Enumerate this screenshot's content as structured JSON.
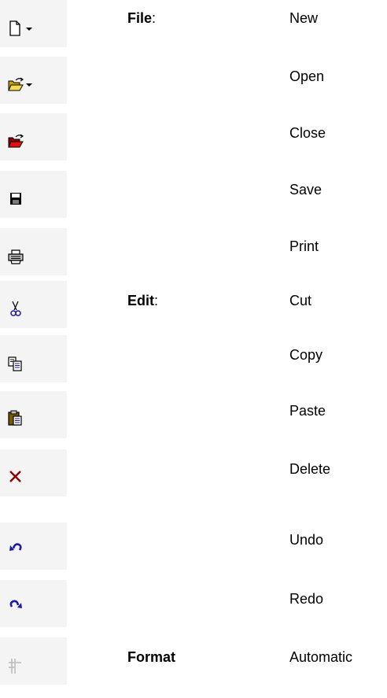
{
  "rows": [
    {
      "icon": "new-document-dropdown-icon",
      "category": "File",
      "category_suffix": ":",
      "command": "New"
    },
    {
      "icon": "open-folder-dropdown-icon",
      "category": "",
      "category_suffix": "",
      "command": "Open"
    },
    {
      "icon": "close-folder-icon",
      "category": "",
      "category_suffix": "",
      "command": "Close"
    },
    {
      "icon": "save-disk-icon",
      "category": "",
      "category_suffix": "",
      "command": "Save"
    },
    {
      "icon": "printer-icon",
      "category": "",
      "category_suffix": "",
      "command": "Print"
    },
    {
      "icon": "scissors-icon",
      "category": "Edit",
      "category_suffix": ":",
      "command": "Cut"
    },
    {
      "icon": "copy-icon",
      "category": "",
      "category_suffix": "",
      "command": "Copy"
    },
    {
      "icon": "paste-clipboard-icon",
      "category": "",
      "category_suffix": "",
      "command": "Paste"
    },
    {
      "icon": "delete-x-icon",
      "category": "",
      "category_suffix": "",
      "command": "Delete"
    },
    {
      "icon": "undo-arrow-icon",
      "category": "",
      "category_suffix": "",
      "command": "Undo"
    },
    {
      "icon": "redo-arrow-icon",
      "category": "",
      "category_suffix": "",
      "command": "Redo"
    },
    {
      "icon": "automatic-format-icon",
      "category": "Format",
      "category_suffix": "",
      "command": "Automatic"
    }
  ]
}
